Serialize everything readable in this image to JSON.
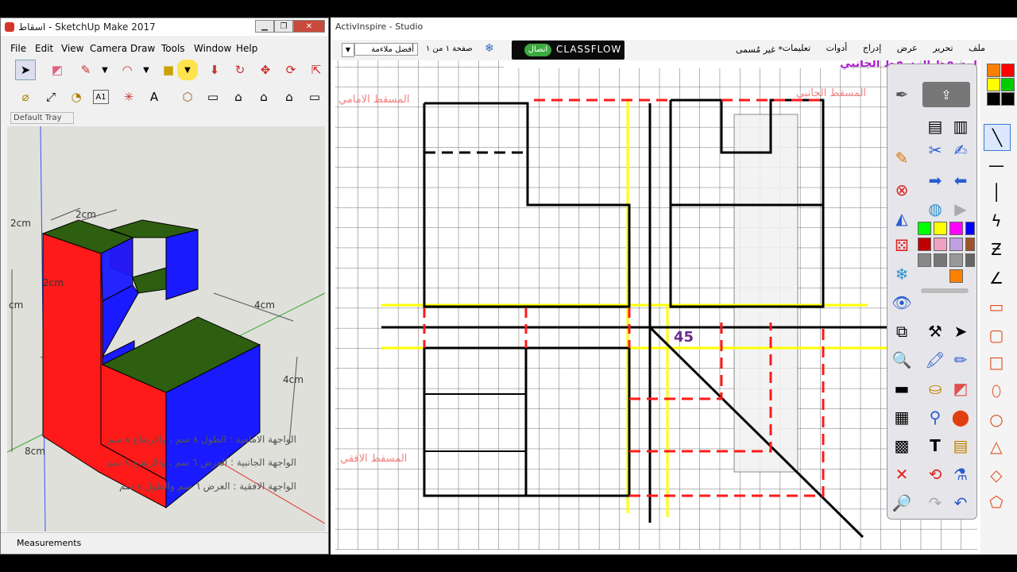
{
  "sketchup": {
    "title": "اسقاط - SketchUp Make 2017",
    "menu": [
      "File",
      "Edit",
      "View",
      "Camera",
      "Draw",
      "Tools",
      "Window",
      "Help"
    ],
    "tray_label": "Default Tray",
    "status": "Measurements",
    "dims": {
      "d1": "2cm",
      "d2": "2cm",
      "d3": "2cm",
      "d4": "4cm",
      "d5": "4cm",
      "d6": "cm",
      "d7": "8cm"
    },
    "notes": [
      "الواجهة الامامية : الطول ٨ سم ، والارتفاع ٨ سم",
      "الواجهة الجانبية : العرض ٦ سم ، والارتفاع ٨ سم",
      "الواجهة الافقية : العرض ٦ سم والطول ٨ سم"
    ]
  },
  "activ": {
    "title": "ActivInspire - Studio",
    "menu": [
      "ملف",
      "تحرير",
      "عرض",
      "إدراج",
      "أدوات",
      "تعليمات"
    ],
    "doc_tab": "* غير مُسمى",
    "classflow": "CLASSFLOW",
    "connect": "اتصال",
    "page_info": "صفحة ١ من ١",
    "fit": "أفضل ملاءمة",
    "canvas": {
      "front_label": "المسقط الامامي",
      "side_label": "المسقط الجانبي",
      "top_label": "المسقط الافقي",
      "angle_label": "45",
      "heading": "مرسمي بمسطح المسقط المسقط الجانبي"
    }
  },
  "colors": {
    "accent_red": "#ff0000",
    "yellow": "#ffff00",
    "blue": "#0000cc",
    "green": "#2e5e10"
  }
}
